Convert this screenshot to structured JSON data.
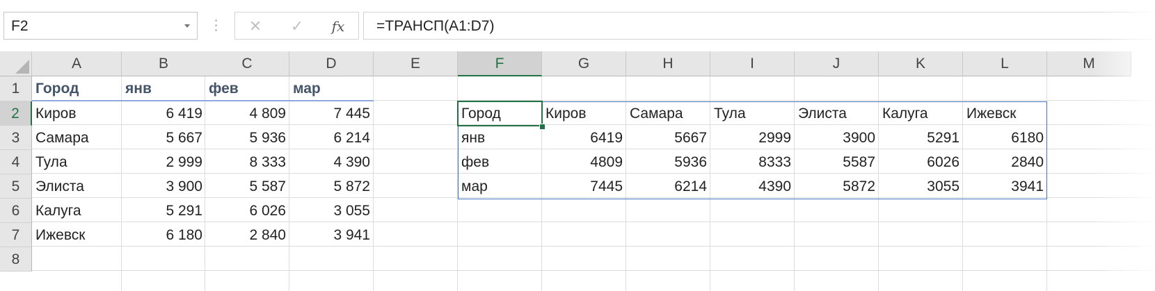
{
  "name_box": {
    "value": "F2"
  },
  "formula_bar": {
    "cancel_glyph": "✕",
    "enter_glyph": "✓",
    "fx_label": "fx",
    "formula": "=ТРАНСП(A1:D7)"
  },
  "columns": [
    "A",
    "B",
    "C",
    "D",
    "E",
    "F",
    "G",
    "H",
    "I",
    "J",
    "K",
    "L",
    "M"
  ],
  "selected_column": "F",
  "rows": [
    "1",
    "2",
    "3",
    "4",
    "5",
    "6",
    "7",
    "8"
  ],
  "selected_row": "2",
  "source_table": {
    "headers": [
      "Город",
      "янв",
      "фев",
      "мар"
    ],
    "rows": [
      [
        "Киров",
        "6 419",
        "4 809",
        "7 445"
      ],
      [
        "Самара",
        "5 667",
        "5 936",
        "6 214"
      ],
      [
        "Тула",
        "2 999",
        "8 333",
        "4 390"
      ],
      [
        "Элиста",
        "3 900",
        "5 587",
        "5 872"
      ],
      [
        "Калуга",
        "5 291",
        "6 026",
        "3 055"
      ],
      [
        "Ижевск",
        "6 180",
        "2 840",
        "3 941"
      ]
    ]
  },
  "transposed_table": {
    "rows": [
      [
        "Город",
        "Киров",
        "Самара",
        "Тула",
        "Элиста",
        "Калуга",
        "Ижевск"
      ],
      [
        "янв",
        "6419",
        "5667",
        "2999",
        "3900",
        "5291",
        "6180"
      ],
      [
        "фев",
        "4809",
        "5936",
        "8333",
        "5587",
        "6026",
        "2840"
      ],
      [
        "мар",
        "7445",
        "6214",
        "4390",
        "5872",
        "3055",
        "3941"
      ]
    ]
  },
  "colors": {
    "accent_green": "#217346",
    "header_text": "#44546a",
    "table_border": "#4472c4",
    "header_underline": "#8ea9db"
  }
}
